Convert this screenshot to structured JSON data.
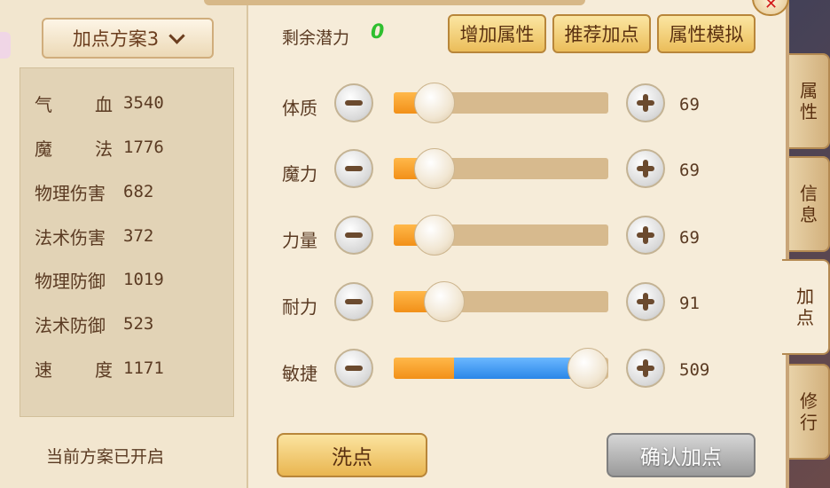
{
  "plan_dropdown": {
    "label": "加点方案3"
  },
  "stats": [
    {
      "name_chars": [
        "气",
        "血"
      ],
      "value": "3540"
    },
    {
      "name_chars": [
        "魔",
        "法"
      ],
      "value": "1776"
    },
    {
      "name": "物理伤害",
      "value": "682"
    },
    {
      "name": "法术伤害",
      "value": "372"
    },
    {
      "name": "物理防御",
      "value": "1019"
    },
    {
      "name": "法术防御",
      "value": "523"
    },
    {
      "name_chars": [
        "速",
        "度"
      ],
      "value": "1171"
    }
  ],
  "plan_status": "当前方案已开启",
  "potential": {
    "label": "剩余潜力",
    "value": "0"
  },
  "top_buttons": {
    "add_attr": "增加属性",
    "recommend": "推荐加点",
    "simulate": "属性模拟"
  },
  "attributes": [
    {
      "label": "体质",
      "value": "69",
      "level": 0.12
    },
    {
      "label": "魔力",
      "value": "69",
      "level": 0.12
    },
    {
      "label": "力量",
      "value": "69",
      "level": 0.12
    },
    {
      "label": "耐力",
      "value": "91",
      "level": 0.17
    },
    {
      "label": "敏捷",
      "value": "509",
      "level": 1.0,
      "base_level": 0.28
    }
  ],
  "buttons": {
    "wash": "洗点",
    "confirm": "确认加点"
  },
  "side_tabs": [
    {
      "chars": [
        "属",
        "性"
      ],
      "active": false
    },
    {
      "chars": [
        "信",
        "息"
      ],
      "active": false
    },
    {
      "chars": [
        "加",
        "点"
      ],
      "active": true
    },
    {
      "chars": [
        "修",
        "行"
      ],
      "active": false
    }
  ],
  "colors": {
    "slider_orange": "#f29018",
    "slider_blue": "#2a86e8",
    "potential_green": "#2fbf2f",
    "close_x": "#d21a1a"
  }
}
